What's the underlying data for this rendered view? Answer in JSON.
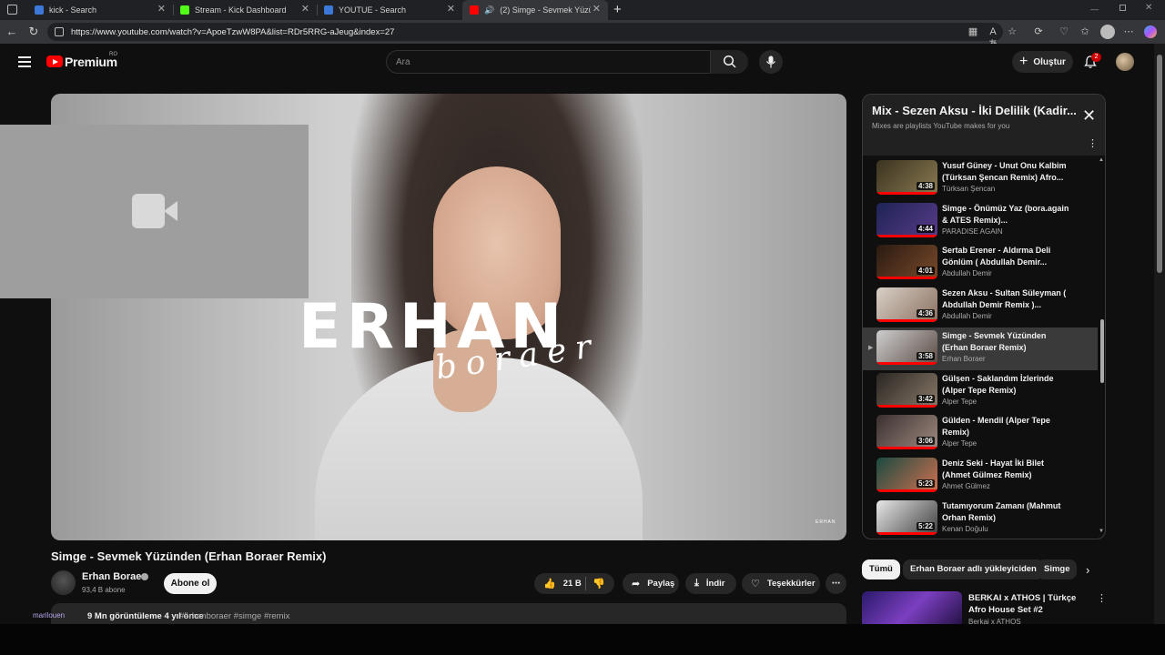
{
  "browser": {
    "tabs": [
      {
        "label": "kick - Search",
        "favicon_color": "#3c78d8"
      },
      {
        "label": "Stream - Kick Dashboard",
        "favicon_color": "#53fc18"
      },
      {
        "label": "YOUTUE - Search",
        "favicon_color": "#3c78d8"
      },
      {
        "label": "(2) Simge - Sevmek Yüzünden",
        "favicon_color": "#ff0000"
      }
    ],
    "url": "https://www.youtube.com/watch?v=ApoeTzwW8PA&list=RDr5RRG-aJeug&index=27",
    "new_tab": "+"
  },
  "header": {
    "logo_text": "Premium",
    "region": "RO",
    "search_placeholder": "Ara",
    "create_label": "Oluştur",
    "notifications_count": "2"
  },
  "video": {
    "brand_main": "ERHAN",
    "brand_script": "boraer",
    "watermark": "ERHAN",
    "title": "Simge - Sevmek Yüzünden (Erhan Boraer Remix)",
    "channel": "Erhan Boraer",
    "subscribers": "93,4 B abone",
    "subscribe_label": "Abone ol",
    "likes": "21 B",
    "share_label": "Paylaş",
    "download_label": "İndir",
    "thanks_label": "Teşekkürler",
    "views_line": "9 Mn görüntüleme  4 yıl önce",
    "hashtags": "#erhanboraer #simge #remix",
    "overlay_text": "marilouen"
  },
  "playlist": {
    "title": "Mix - Sezen Aksu - İki Delilik (Kadir...",
    "subtitle": "Mixes are playlists YouTube makes for you",
    "items": [
      {
        "title": "Yusuf Güney - Unut Onu Kalbim (Türksan Şencan Remix) Afro...",
        "channel": "Türksan Şencan",
        "duration": "4:38",
        "c1": "#3b3320",
        "c2": "#8a7a52",
        "current": false
      },
      {
        "title": "Simge - Önümüz Yaz (bora.again & ATES Remix)...",
        "channel": "PARADISE AGAIN",
        "duration": "4:44",
        "c1": "#1d2455",
        "c2": "#5a3a8a",
        "current": false
      },
      {
        "title": "Sertab Erener - Aldırma Deli Gönlüm ( Abdullah Demir...",
        "channel": "Abdullah Demir",
        "duration": "4:01",
        "c1": "#2a1a12",
        "c2": "#7a4a2a",
        "current": false
      },
      {
        "title": "Sezen Aksu - Sultan Süleyman ( Abdullah Demir Remix )...",
        "channel": "Abdullah Demir",
        "duration": "4:36",
        "c1": "#d9d0c7",
        "c2": "#8a7060",
        "current": false
      },
      {
        "title": "Simge - Sevmek Yüzünden (Erhan Boraer Remix)",
        "channel": "Erhan Boraer",
        "duration": "3:58",
        "c1": "#cfcfcf",
        "c2": "#5a4a44",
        "current": true
      },
      {
        "title": "Gülşen - Saklandım İzlerinde (Alper Tepe Remix)",
        "channel": "Alper Tepe",
        "duration": "3:42",
        "c1": "#2a2622",
        "c2": "#8a7a6a",
        "current": false
      },
      {
        "title": "Gülden - Mendil (Alper Tepe Remix)",
        "channel": "Alper Tepe",
        "duration": "3:06",
        "c1": "#3a3030",
        "c2": "#a08a80",
        "current": false
      },
      {
        "title": "Deniz Seki - Hayat İki Bilet (Ahmet Gülmez Remix)",
        "channel": "Ahmet Gülmez",
        "duration": "5:23",
        "c1": "#1a4a40",
        "c2": "#d07050",
        "current": false
      },
      {
        "title": "Tutamıyorum Zamanı (Mahmut Orhan Remix)",
        "channel": "Kenan Doğulu",
        "duration": "5:22",
        "c1": "#e8e8e8",
        "c2": "#404040",
        "current": false
      }
    ]
  },
  "chips": [
    "Tümü",
    "Erhan Boraer adlı yükleyiciden",
    "Simge"
  ],
  "recommendation": {
    "title": "BERKAI x ATHOS | Türkçe Afro House Set #2",
    "channel": "Berkai x ATHOS"
  }
}
